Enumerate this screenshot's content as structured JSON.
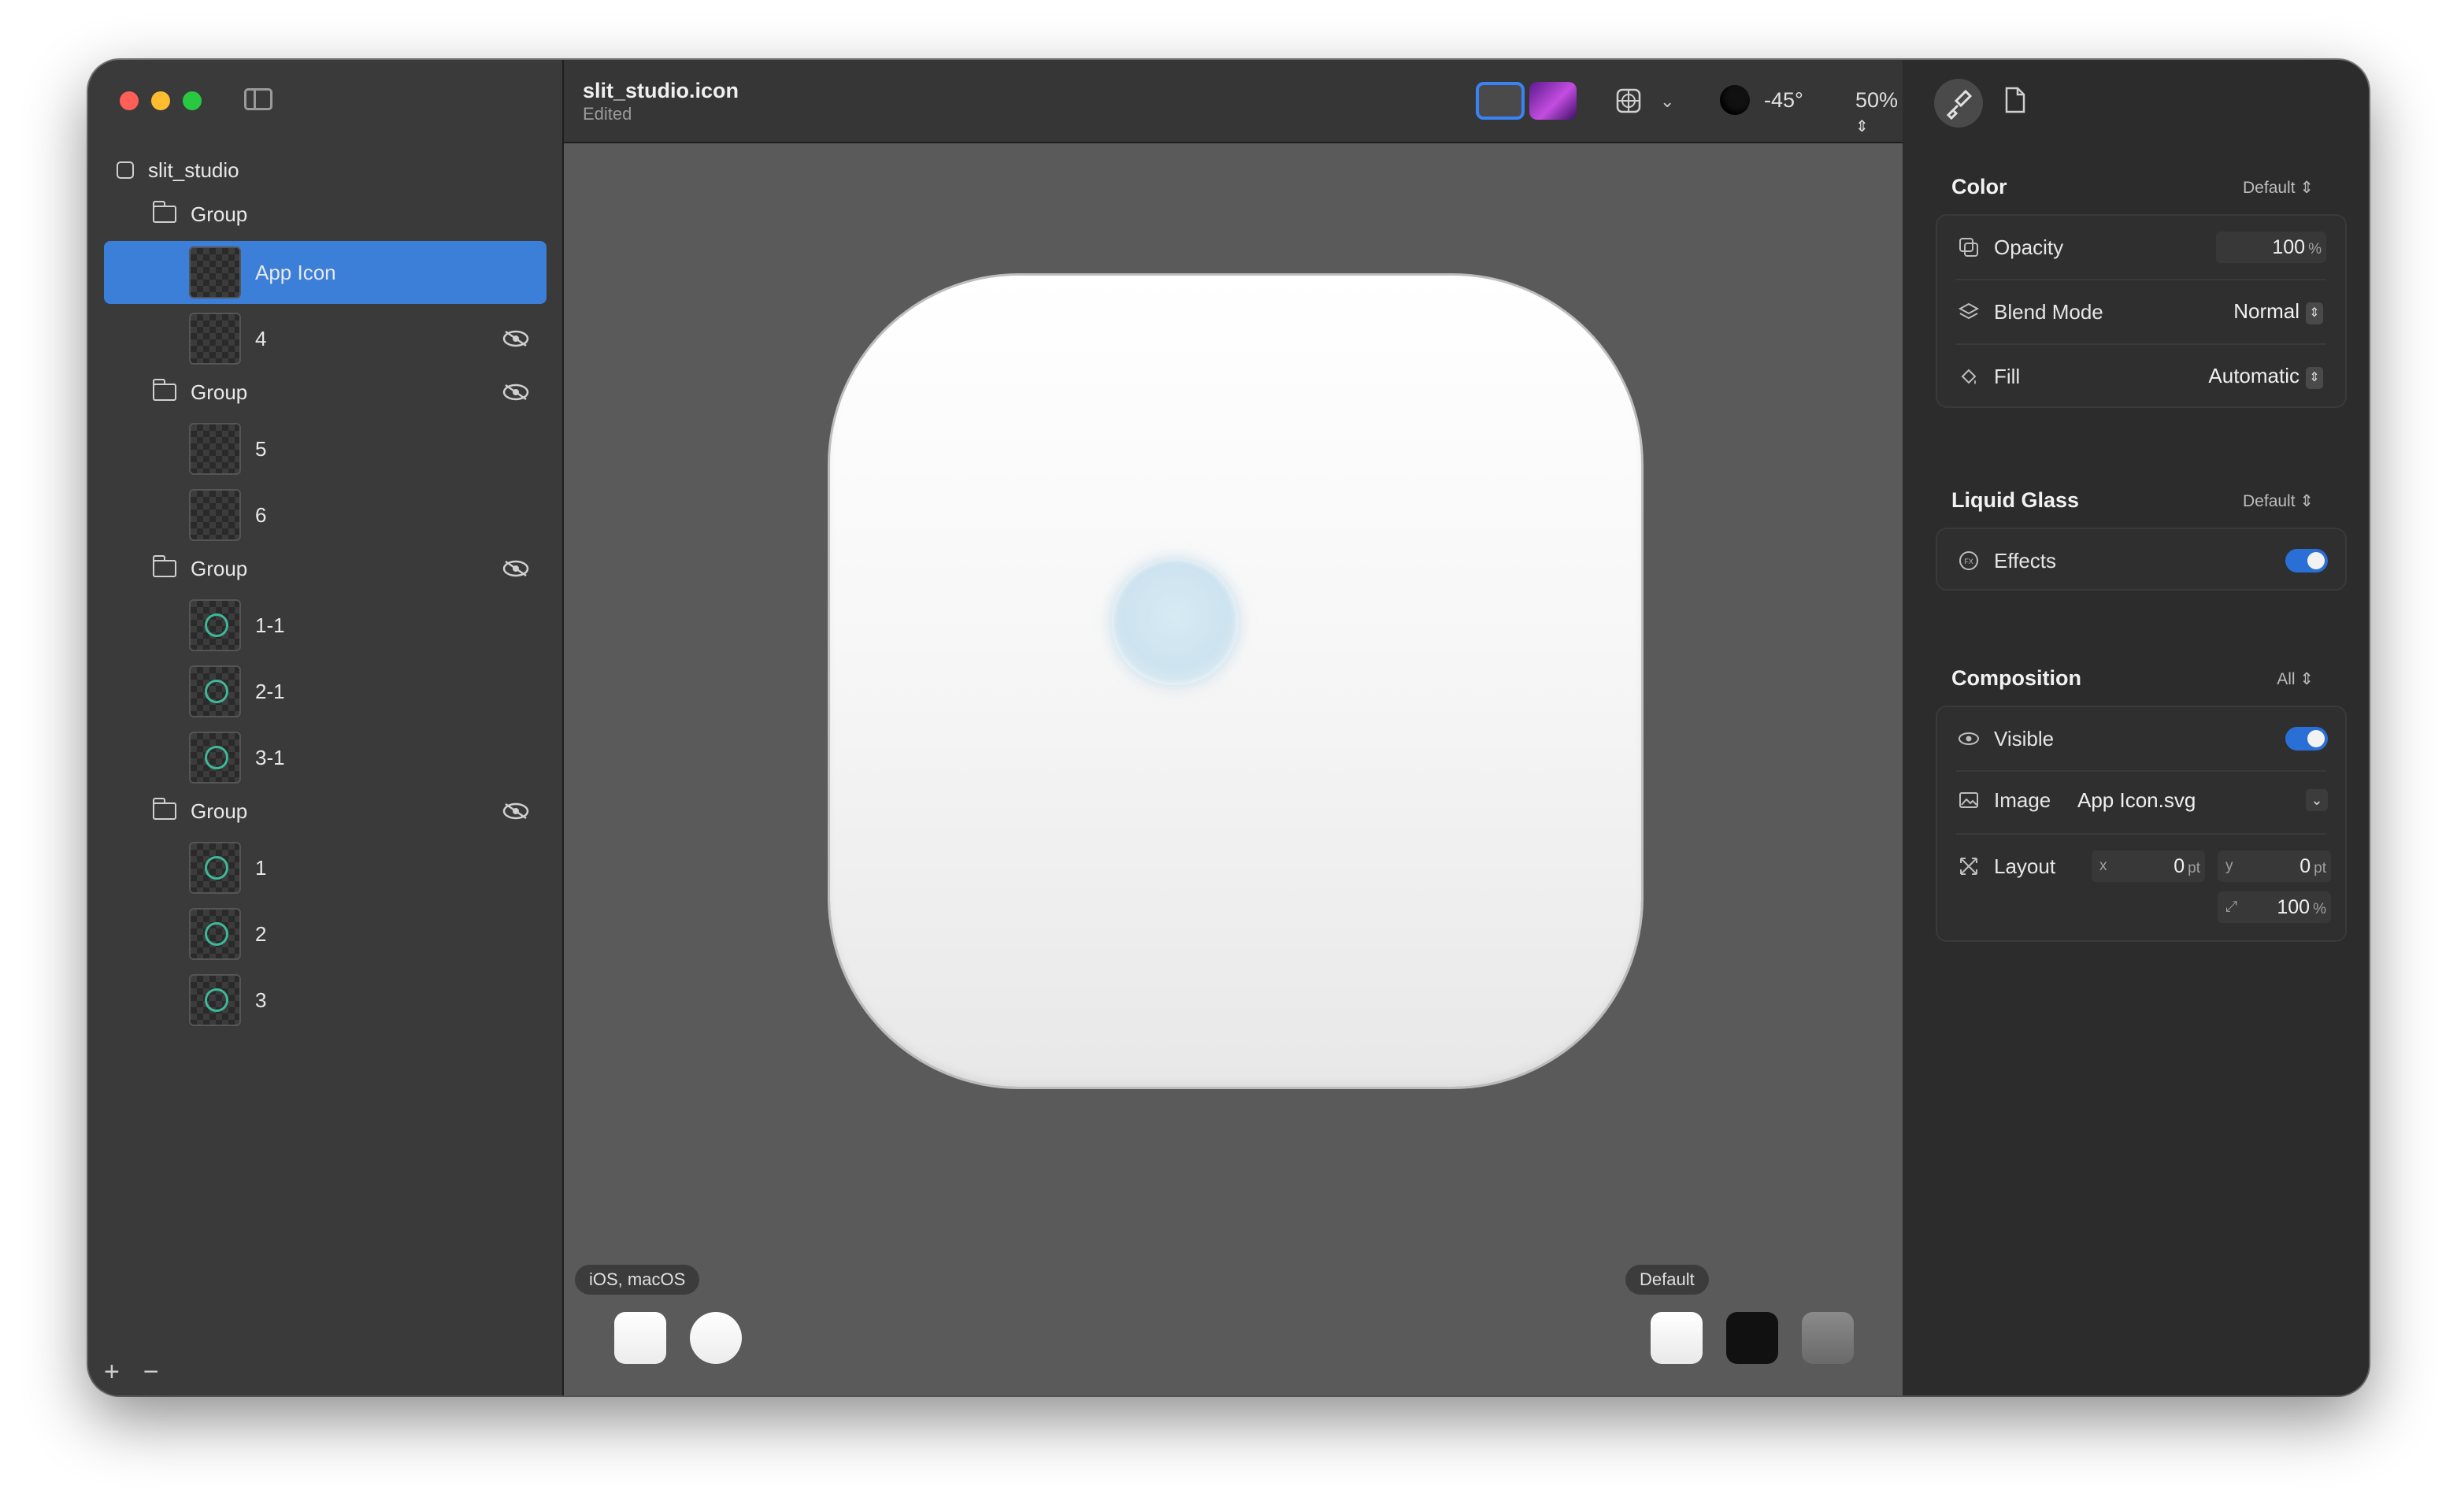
{
  "sidebar": {
    "root_label": "slit_studio",
    "items": [
      {
        "type": "group",
        "label": "Group",
        "eye": false
      },
      {
        "type": "layer",
        "label": "App Icon",
        "selected": true,
        "thumb": "dot"
      },
      {
        "type": "layer",
        "label": "4",
        "eye": true,
        "thumb": "dot"
      },
      {
        "type": "group",
        "label": "Group",
        "eye": true
      },
      {
        "type": "layer",
        "label": "5",
        "thumb": "dot"
      },
      {
        "type": "layer",
        "label": "6",
        "thumb": "dot"
      },
      {
        "type": "group",
        "label": "Group",
        "eye": true
      },
      {
        "type": "layer",
        "label": "1-1",
        "thumb": "ring"
      },
      {
        "type": "layer",
        "label": "2-1",
        "thumb": "ring"
      },
      {
        "type": "layer",
        "label": "3-1",
        "thumb": "ring"
      },
      {
        "type": "group",
        "label": "Group",
        "eye": true
      },
      {
        "type": "layer",
        "label": "1",
        "thumb": "ring"
      },
      {
        "type": "layer",
        "label": "2",
        "thumb": "ring"
      },
      {
        "type": "layer",
        "label": "3",
        "thumb": "ring"
      }
    ],
    "add_label": "+",
    "remove_label": "−"
  },
  "toolbar": {
    "doc_name": "slit_studio.icon",
    "doc_status": "Edited",
    "light_angle": "-45°",
    "zoom": "50%"
  },
  "canvas": {
    "platform_label": "iOS, macOS",
    "appearance_label": "Default",
    "background_color": "#5a5a5a"
  },
  "inspector": {
    "color": {
      "title": "Color",
      "mode": "Default",
      "opacity_label": "Opacity",
      "opacity_value": "100",
      "opacity_unit": "%",
      "blend_label": "Blend Mode",
      "blend_value": "Normal",
      "fill_label": "Fill",
      "fill_value": "Automatic"
    },
    "glass": {
      "title": "Liquid Glass",
      "mode": "Default",
      "effects_label": "Effects",
      "effects_on": true
    },
    "composition": {
      "title": "Composition",
      "mode": "All",
      "visible_label": "Visible",
      "visible_on": true,
      "image_label": "Image",
      "image_value": "App Icon.svg",
      "layout_label": "Layout",
      "x_prefix": "x",
      "x_value": "0",
      "y_prefix": "y",
      "y_value": "0",
      "pt_unit": "pt",
      "scale_value": "100",
      "scale_unit": "%"
    },
    "accent_color": "#2a6fd6"
  }
}
